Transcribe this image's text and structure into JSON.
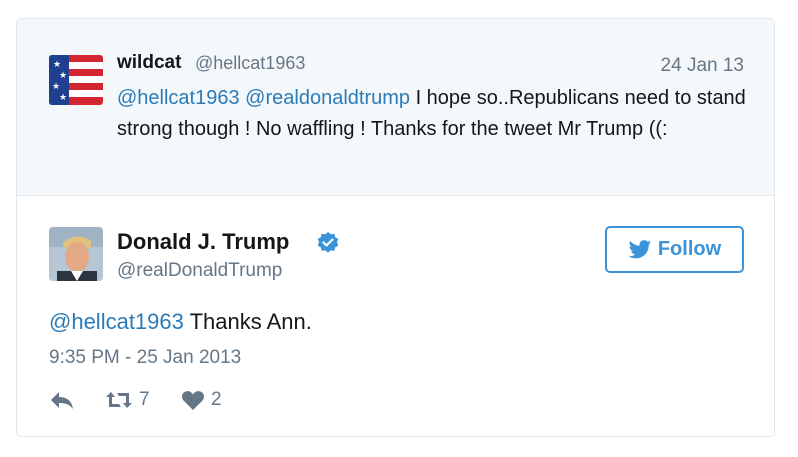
{
  "quoted_tweet": {
    "name": "wildcat",
    "handle": "@hellcat1963",
    "date": "24 Jan 13",
    "mention1": "@hellcat1963",
    "mention2": "@realdonaldtrump",
    "body": " I hope so..Republicans need to stand strong though ! No waffling ! Thanks for the tweet Mr Trump ((:",
    "avatar_icon": "us-flag-avatar"
  },
  "main_tweet": {
    "name": "Donald J. Trump",
    "handle": "@realDonaldTrump",
    "verified_icon": "verified-badge-icon",
    "mention": "@hellcat1963",
    "body": " Thanks Ann.",
    "timestamp": "9:35 PM - 25 Jan 2013"
  },
  "follow_button": {
    "label": "Follow",
    "icon": "twitter-bird-icon"
  },
  "actions": {
    "reply_icon": "reply-icon",
    "retweet_icon": "retweet-icon",
    "retweet_count": "7",
    "like_icon": "heart-icon",
    "like_count": "2"
  },
  "colors": {
    "link": "#2b7bb9",
    "accent": "#3b94d9",
    "muted": "#657786",
    "quoted_bg": "#f5f8fa"
  }
}
